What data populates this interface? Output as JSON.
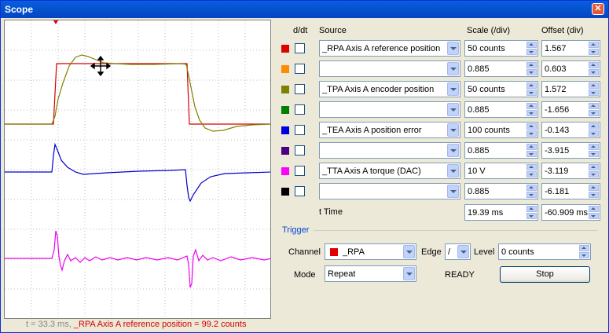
{
  "window": {
    "title": "Scope",
    "close_icon": "close-icon"
  },
  "headers": {
    "ddt": "d/dt",
    "source": "Source",
    "scale": "Scale (/div)",
    "offset": "Offset (div)"
  },
  "channels": [
    {
      "color": "#e00000",
      "source": "_RPA Axis A reference position",
      "scale": "50 counts",
      "offset": "1.567"
    },
    {
      "color": "#ff8c00",
      "source": "",
      "scale": "0.885",
      "offset": "0.603"
    },
    {
      "color": "#808000",
      "source": "_TPA Axis A encoder position",
      "scale": "50 counts",
      "offset": "1.572"
    },
    {
      "color": "#008000",
      "source": "",
      "scale": "0.885",
      "offset": "-1.656"
    },
    {
      "color": "#0000dd",
      "source": "_TEA Axis A position error",
      "scale": "100 counts",
      "offset": "-0.143"
    },
    {
      "color": "#4b0082",
      "source": "",
      "scale": "0.885",
      "offset": "-3.915"
    },
    {
      "color": "#ff00ff",
      "source": "_TTA Axis A torque (DAC)",
      "scale": "10 V",
      "offset": "-3.119"
    },
    {
      "color": "#000000",
      "source": "",
      "scale": "0.885",
      "offset": "-6.181"
    }
  ],
  "time": {
    "label": "t Time",
    "scale": "19.39 ms",
    "offset": "-60.909 ms"
  },
  "trigger": {
    "section_label": "Trigger",
    "channel_label": "Channel",
    "channel_value": "_RPA",
    "channel_color": "#e00000",
    "edge_label": "Edge",
    "edge_value": "/",
    "level_label": "Level",
    "level_value": "0 counts",
    "mode_label": "Mode",
    "mode_value": "Repeat",
    "state": "READY",
    "stop_label": "Stop"
  },
  "status": {
    "time_text": "t = 33.3 ms,",
    "value_text": "_RPA Axis A reference position = 99.2 counts"
  },
  "cursor_icon": "move-cursor-icon"
}
